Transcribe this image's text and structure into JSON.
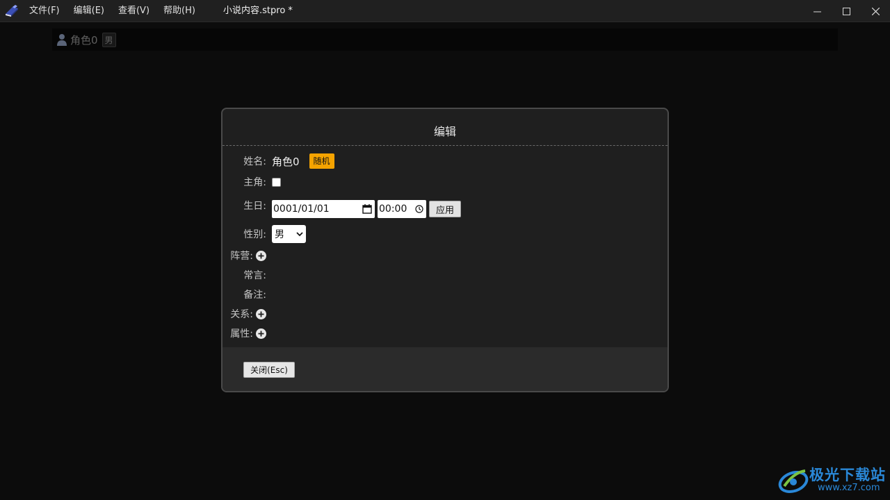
{
  "menu": {
    "items": [
      "文件(F)",
      "编辑(E)",
      "查看(V)",
      "帮助(H)"
    ]
  },
  "window": {
    "title": "小说内容.stpro *"
  },
  "character_bar": {
    "name": "角色0",
    "gender": "男"
  },
  "dialog": {
    "title": "编辑",
    "name_label": "姓名:",
    "name_value": "角色0",
    "random_label": "随机",
    "protagonist_label": "主角:",
    "protagonist_checked": false,
    "birthday_label": "生日:",
    "birthday_date": "0001/01/01",
    "birthday_time": "00:00",
    "apply_label": "应用",
    "gender_label": "性别:",
    "gender_value": "男",
    "faction_label": "阵营:",
    "saying_label": "常言:",
    "note_label": "备注:",
    "relation_label": "关系:",
    "attribute_label": "属性:",
    "close_label": "关闭(Esc)"
  },
  "watermark": {
    "text_cn": "极光下载站",
    "url": "www.xz7.com"
  },
  "colors": {
    "accent_orange": "#f5a300",
    "background": "#0c0c0c",
    "dialog_bg": "#1f1f1f"
  }
}
